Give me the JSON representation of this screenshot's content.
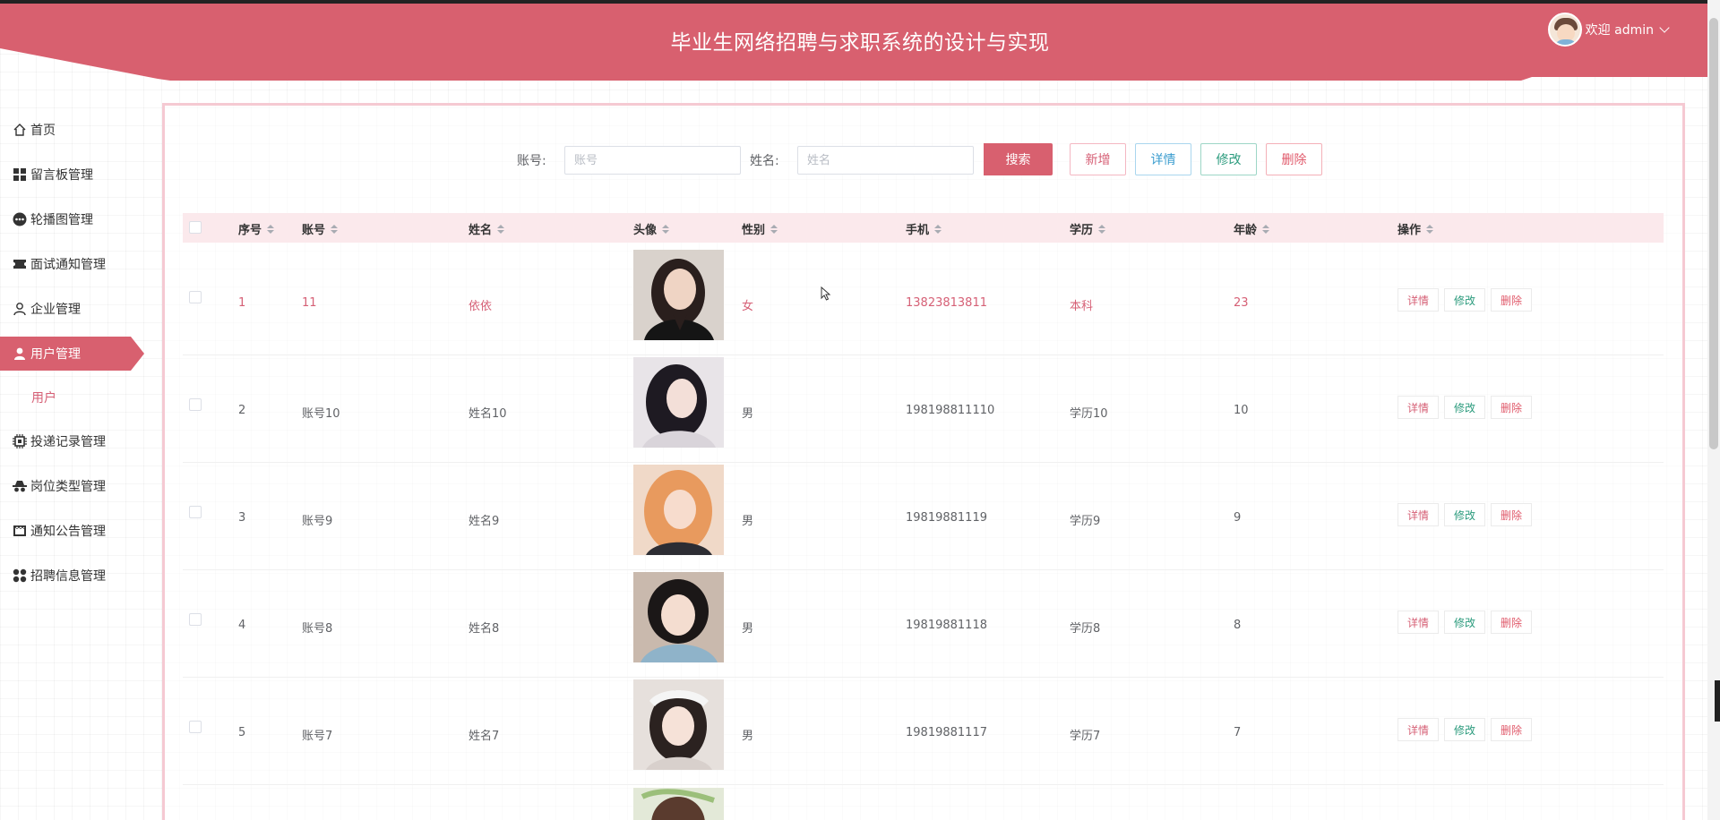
{
  "header": {
    "title": "毕业生网络招聘与求职系统的设计与实现",
    "welcome": "欢迎 admin"
  },
  "sidebar": {
    "items": [
      {
        "label": "首页",
        "icon": "home-icon"
      },
      {
        "label": "留言板管理",
        "icon": "grid-icon"
      },
      {
        "label": "轮播图管理",
        "icon": "dots-icon"
      },
      {
        "label": "面试通知管理",
        "icon": "ticket-icon"
      },
      {
        "label": "企业管理",
        "icon": "person-outline-icon"
      },
      {
        "label": "用户管理",
        "icon": "person-icon",
        "active": true
      },
      {
        "label": "投递记录管理",
        "icon": "chip-icon"
      },
      {
        "label": "岗位类型管理",
        "icon": "spy-icon"
      },
      {
        "label": "通知公告管理",
        "icon": "shop-icon"
      },
      {
        "label": "招聘信息管理",
        "icon": "apps-icon"
      }
    ],
    "submenu": "用户"
  },
  "search": {
    "account_label": "账号:",
    "account_placeholder": "账号",
    "name_label": "姓名:",
    "name_placeholder": "姓名",
    "search_button": "搜索",
    "add_button": "新增",
    "detail_button": "详情",
    "edit_button": "修改",
    "delete_button": "删除"
  },
  "table": {
    "columns": [
      "序号",
      "账号",
      "姓名",
      "头像",
      "性别",
      "手机",
      "学历",
      "年龄",
      "操作"
    ],
    "rows": [
      {
        "index": "1",
        "account": "11",
        "name": "依依",
        "gender": "女",
        "phone": "13823813811",
        "education": "本科",
        "age": "23"
      },
      {
        "index": "2",
        "account": "账号10",
        "name": "姓名10",
        "gender": "男",
        "phone": "198198811110",
        "education": "学历10",
        "age": "10"
      },
      {
        "index": "3",
        "account": "账号9",
        "name": "姓名9",
        "gender": "男",
        "phone": "19819881119",
        "education": "学历9",
        "age": "9"
      },
      {
        "index": "4",
        "account": "账号8",
        "name": "姓名8",
        "gender": "男",
        "phone": "19819881118",
        "education": "学历8",
        "age": "8"
      },
      {
        "index": "5",
        "account": "账号7",
        "name": "姓名7",
        "gender": "男",
        "phone": "19819881117",
        "education": "学历7",
        "age": "7"
      }
    ],
    "row_actions": {
      "detail": "详情",
      "edit": "修改",
      "delete": "删除"
    }
  },
  "colors": {
    "primary": "#d8606f",
    "primary_text": "#d66076",
    "header_bg": "#d8606f",
    "table_head_bg": "#fbe9ec"
  }
}
